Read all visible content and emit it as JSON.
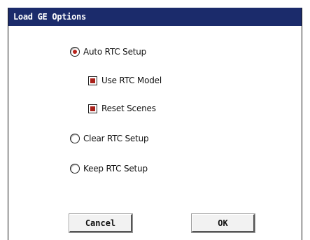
{
  "dialog": {
    "title": "Load GE Options",
    "options": {
      "auto_rtc_setup": {
        "label": "Auto RTC Setup",
        "checked": true
      },
      "use_rtc_model": {
        "label": "Use RTC Model",
        "checked": true
      },
      "reset_scenes": {
        "label": "Reset Scenes",
        "checked": true
      },
      "clear_rtc_setup": {
        "label": "Clear RTC Setup",
        "checked": false
      },
      "keep_rtc_setup": {
        "label": "Keep RTC Setup",
        "checked": false
      }
    },
    "buttons": {
      "cancel_label": "Cancel",
      "ok_label": "OK"
    }
  },
  "colors": {
    "titlebar": "#1b2b6b",
    "accent": "#b8231b"
  }
}
